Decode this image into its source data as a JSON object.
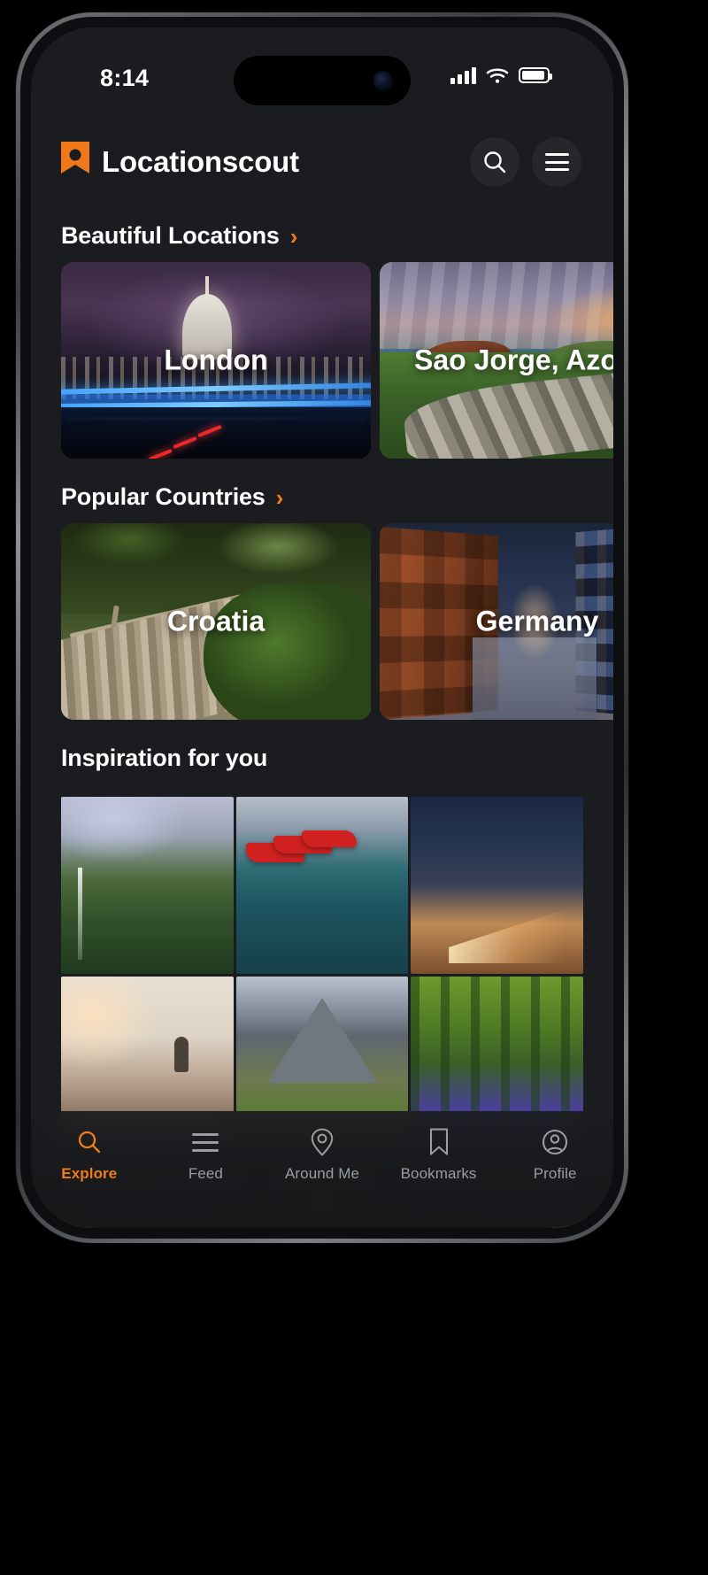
{
  "status_bar": {
    "time": "8:14",
    "icons": [
      "cellular-signal-icon",
      "wifi-icon",
      "battery-icon"
    ]
  },
  "header": {
    "brand": "Locationscout",
    "logo_icon": "map-pin-logo",
    "search_icon": "search-icon",
    "menu_icon": "hamburger-menu-icon",
    "accent_color": "#ef7d1a"
  },
  "sections": [
    {
      "title": "Beautiful Locations",
      "has_chevron": true,
      "chevron_icon": "chevron-right-icon",
      "cards": [
        {
          "label": "London",
          "art": "ph-london"
        },
        {
          "label": "Sao Jorge, Azores",
          "art": "ph-azores"
        }
      ]
    },
    {
      "title": "Popular Countries",
      "has_chevron": true,
      "chevron_icon": "chevron-right-icon",
      "cards": [
        {
          "label": "Croatia",
          "art": "ph-croatia"
        },
        {
          "label": "Germany",
          "art": "ph-germany"
        }
      ]
    },
    {
      "title": "Inspiration for you",
      "has_chevron": false,
      "grid": [
        {
          "art": "g-cliffs"
        },
        {
          "art": "g-canoes"
        },
        {
          "art": "g-city"
        },
        {
          "art": "g-coast"
        },
        {
          "art": "g-alps"
        },
        {
          "art": "g-blue"
        },
        {
          "art": "g-fjord"
        },
        {
          "art": "g-paris"
        },
        {
          "art": "g-sunset"
        }
      ]
    }
  ],
  "tab_bar": {
    "active_color": "#ef7d1a",
    "inactive_color": "#9b9ca0",
    "tabs": [
      {
        "label": "Explore",
        "icon": "search-icon",
        "active": true
      },
      {
        "label": "Feed",
        "icon": "feed-lines-icon",
        "active": false
      },
      {
        "label": "Around Me",
        "icon": "map-pin-icon",
        "active": false
      },
      {
        "label": "Bookmarks",
        "icon": "bookmark-icon",
        "active": false
      },
      {
        "label": "Profile",
        "icon": "user-circle-icon",
        "active": false
      }
    ]
  }
}
